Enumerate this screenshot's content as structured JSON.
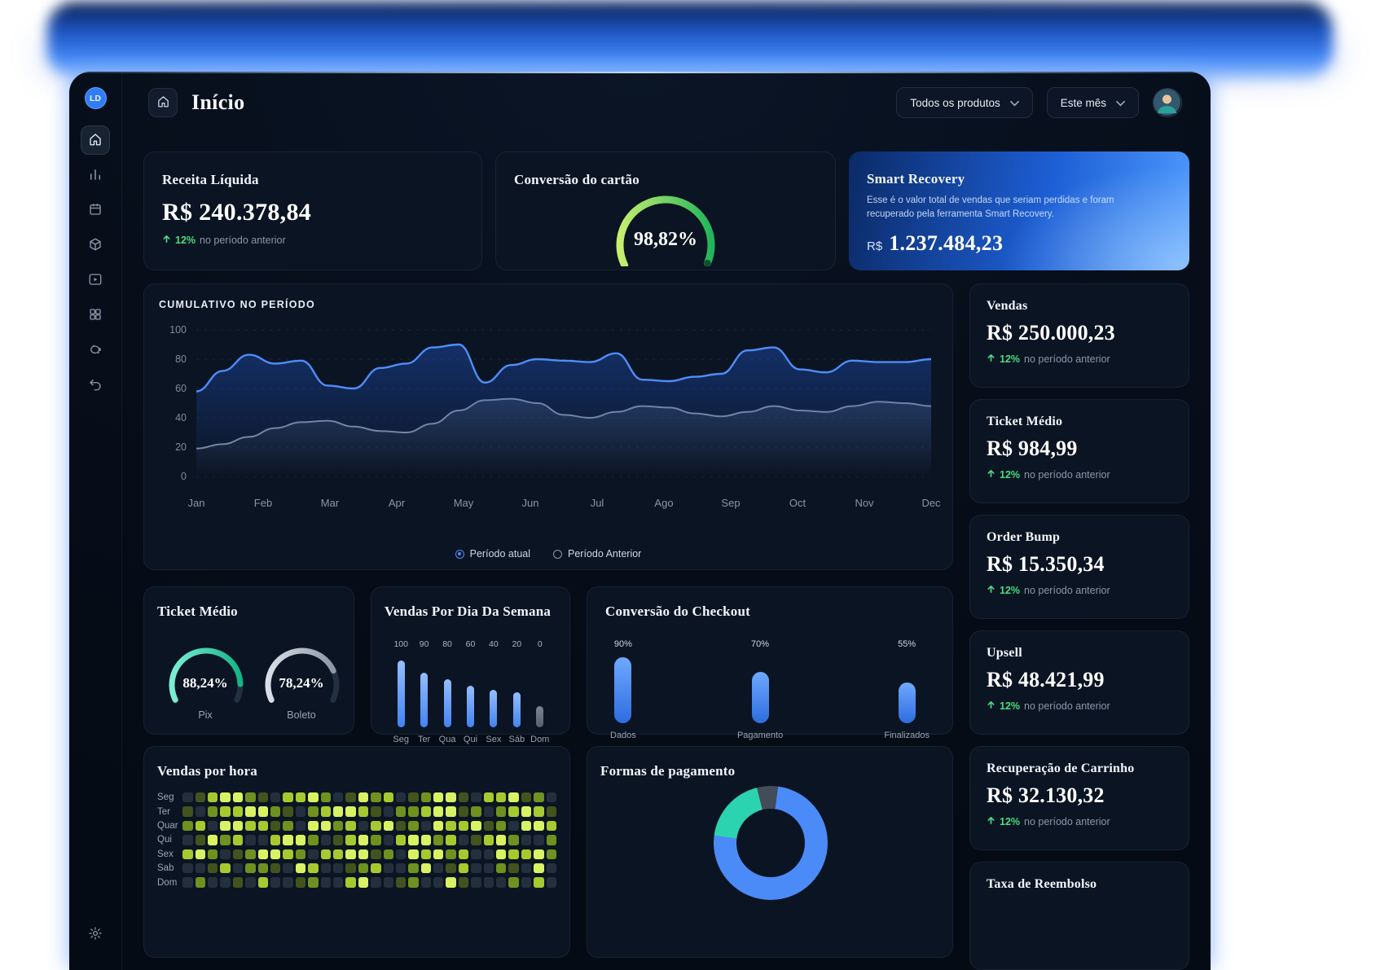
{
  "header": {
    "title": "Início",
    "product_filter": "Todos os produtos",
    "period_filter": "Este mês"
  },
  "sidebar": {
    "avatar": "LD"
  },
  "kpi": {
    "receita": {
      "title": "Receita Líquida",
      "value": "R$ 240.378,84",
      "delta": "12%",
      "note": "no período anterior"
    },
    "conversao_cartao": {
      "title": "Conversão do cartão",
      "value": "98,82%",
      "percent": 98.82,
      "colors": [
        "#c6ef6e",
        "#22b65a"
      ],
      "dot_color": "#0d4f2e"
    },
    "smart_recovery": {
      "title": "Smart Recovery",
      "description": "Esse é o valor total de vendas que seriam perdidas e foram recuperado pela ferramenta Smart Recovery.",
      "currency": "R$",
      "value": "1.237.484,23"
    }
  },
  "stats": [
    {
      "title": "Vendas",
      "value": "R$ 250.000,23",
      "delta": "12%",
      "note": "no período anterior"
    },
    {
      "title": "Ticket Médio",
      "value": "R$ 984,99",
      "delta": "12%",
      "note": "no período anterior"
    },
    {
      "title": "Order Bump",
      "value": "R$ 15.350,34",
      "delta": "12%",
      "note": "no período anterior"
    },
    {
      "title": "Upsell",
      "value": "R$ 48.421,99",
      "delta": "12%",
      "note": "no período anterior"
    },
    {
      "title": "Recuperação de Carrinho",
      "value": "R$ 32.130,32",
      "delta": "12%",
      "note": "no período anterior"
    },
    {
      "title": "Taxa de Reembolso"
    }
  ],
  "chart_data": [
    {
      "id": "cumulativo",
      "type": "area",
      "title": "CUMULATIVO NO PERÍODO",
      "x_labels": [
        "Jan",
        "Feb",
        "Mar",
        "Apr",
        "May",
        "Jun",
        "Jul",
        "Ago",
        "Sep",
        "Oct",
        "Nov",
        "Dec"
      ],
      "y_ticks": [
        0,
        20,
        40,
        60,
        80,
        100
      ],
      "ylim": [
        0,
        100
      ],
      "grid": "dashed-horizontal",
      "legend_position": "bottom-center",
      "series": [
        {
          "name": "Período atual",
          "color": "#4f8df9",
          "values": [
            58,
            72,
            83,
            77,
            79,
            62,
            60,
            74,
            77,
            88,
            90,
            64,
            76,
            80,
            79,
            78,
            84,
            66,
            65,
            68,
            70,
            86,
            88,
            73,
            71,
            79,
            78,
            78,
            80
          ]
        },
        {
          "name": "Período Anterior",
          "color": "#8b96a6",
          "values": [
            19,
            22,
            27,
            33,
            37,
            38,
            34,
            31,
            30,
            36,
            45,
            52,
            53,
            50,
            42,
            40,
            44,
            48,
            47,
            43,
            41,
            44,
            48,
            45,
            44,
            48,
            51,
            50,
            48
          ]
        }
      ]
    },
    {
      "id": "vendas_dia_semana",
      "type": "bar",
      "title": "Vendas Por Dia Da Semana",
      "axis_labels": [
        "100",
        "90",
        "80",
        "60",
        "40",
        "20",
        "0"
      ],
      "categories": [
        "Seg",
        "Ter",
        "Qua",
        "Qui",
        "Sex",
        "Sáb",
        "Dom"
      ],
      "values": [
        100,
        82,
        72,
        62,
        56,
        52,
        32
      ],
      "bar_color": "#5f9bf7",
      "last_bar_color": "#68727f"
    },
    {
      "id": "conversao_checkout",
      "type": "bar",
      "title": "Conversão do Checkout",
      "categories": [
        "Dados",
        "Pagamento",
        "Finalizados"
      ],
      "values": [
        90,
        70,
        55
      ],
      "value_labels": [
        "90%",
        "70%",
        "55%"
      ],
      "bar_color": "#3f7ded"
    },
    {
      "id": "ticket_medio_gauges",
      "type": "gauge",
      "title": "Ticket Médio",
      "items": [
        {
          "label": "Pix",
          "value": "88,24%",
          "percent": 88.24,
          "stops": [
            "#7beed4",
            "#12b586"
          ]
        },
        {
          "label": "Boleto",
          "value": "78,24%",
          "percent": 78.24,
          "stops": [
            "#d9dfe7",
            "#8c97a5"
          ]
        }
      ]
    },
    {
      "id": "vendas_por_hora",
      "type": "heatmap",
      "title": "Vendas por hora",
      "rows": [
        "Seg",
        "Ter",
        "Quar",
        "Qui",
        "Sex",
        "Sab",
        "Dom"
      ],
      "palette": [
        "#242f3d",
        "#42531e",
        "#6f9120",
        "#a6c92e",
        "#d9f263"
      ],
      "cells": [
        "013442103342014230124410334120",
        "102334421023443102234412023431",
        "230443312044230341204334120443",
        "014230034420134203442301342002",
        "342012443203344120434230043342",
        "001302210430012300240130021040",
        "020010300120034001200410002030"
      ]
    },
    {
      "id": "formas_pagamento",
      "type": "pie",
      "title": "Formas de pagamento",
      "slices": [
        {
          "color": "#434c59",
          "value": 6
        },
        {
          "color": "#4b8bf8",
          "value": 75
        },
        {
          "color": "#2cd3b0",
          "value": 19
        }
      ]
    }
  ]
}
